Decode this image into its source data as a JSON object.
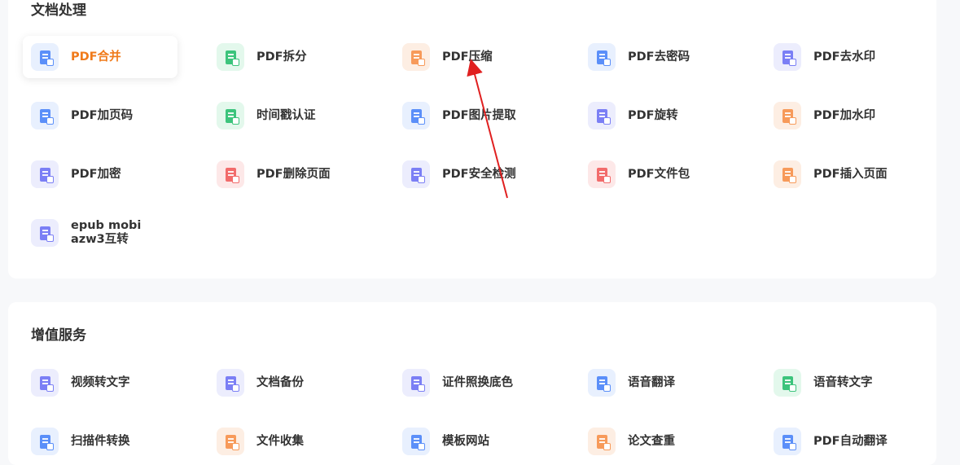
{
  "doc_section": {
    "title": "文档处理",
    "tools": [
      {
        "label": "PDF合并",
        "icon": "pdf-merge-icon",
        "color": "#5b8ff9",
        "bg": "#e8f0fe",
        "active": true
      },
      {
        "label": "PDF拆分",
        "icon": "pdf-split-icon",
        "color": "#3cc47c",
        "bg": "#e3f8ec"
      },
      {
        "label": "PDF压缩",
        "icon": "pdf-compress-icon",
        "color": "#f79a5a",
        "bg": "#fdeee3"
      },
      {
        "label": "PDF去密码",
        "icon": "pdf-remove-password-icon",
        "color": "#5b8ff9",
        "bg": "#e8f0fe"
      },
      {
        "label": "PDF去水印",
        "icon": "pdf-remove-watermark-icon",
        "color": "#7b7ff5",
        "bg": "#ecedfd"
      },
      {
        "label": "PDF加页码",
        "icon": "pdf-add-page-number-icon",
        "color": "#5b8ff9",
        "bg": "#e8f0fe"
      },
      {
        "label": "时间戳认证",
        "icon": "timestamp-icon",
        "color": "#3cc47c",
        "bg": "#e3f8ec"
      },
      {
        "label": "PDF图片提取",
        "icon": "pdf-image-extract-icon",
        "color": "#5b8ff9",
        "bg": "#e8f0fe"
      },
      {
        "label": "PDF旋转",
        "icon": "pdf-rotate-icon",
        "color": "#7b7ff5",
        "bg": "#ecedfd"
      },
      {
        "label": "PDF加水印",
        "icon": "pdf-add-watermark-icon",
        "color": "#f79a5a",
        "bg": "#fdeee3"
      },
      {
        "label": "PDF加密",
        "icon": "pdf-encrypt-icon",
        "color": "#7b7ff5",
        "bg": "#ecedfd"
      },
      {
        "label": "PDF删除页面",
        "icon": "pdf-delete-page-icon",
        "color": "#f26b6b",
        "bg": "#fde8e8"
      },
      {
        "label": "PDF安全检测",
        "icon": "pdf-security-check-icon",
        "color": "#7b7ff5",
        "bg": "#ecedfd"
      },
      {
        "label": "PDF文件包",
        "icon": "pdf-file-package-icon",
        "color": "#f26b6b",
        "bg": "#fde8e8"
      },
      {
        "label": "PDF插入页面",
        "icon": "pdf-insert-page-icon",
        "color": "#f79a5a",
        "bg": "#fdeee3"
      },
      {
        "label": "epub mobi\nazw3互转",
        "icon": "ebook-convert-icon",
        "color": "#7b7ff5",
        "bg": "#ecedfd"
      }
    ]
  },
  "vas_section": {
    "title": "增值服务",
    "tools": [
      {
        "label": "视频转文字",
        "icon": "video-to-text-icon",
        "color": "#7b7ff5",
        "bg": "#ecedfd"
      },
      {
        "label": "文档备份",
        "icon": "document-backup-icon",
        "color": "#7b7ff5",
        "bg": "#ecedfd"
      },
      {
        "label": "证件照换底色",
        "icon": "id-photo-icon",
        "color": "#7b7ff5",
        "bg": "#ecedfd"
      },
      {
        "label": "语音翻译",
        "icon": "voice-translate-icon",
        "color": "#5b8ff9",
        "bg": "#e8f0fe"
      },
      {
        "label": "语音转文字",
        "icon": "voice-to-text-icon",
        "color": "#3cc47c",
        "bg": "#e3f8ec"
      },
      {
        "label": "扫描件转换",
        "icon": "scan-convert-icon",
        "color": "#5b8ff9",
        "bg": "#e8f0fe"
      },
      {
        "label": "文件收集",
        "icon": "file-collect-icon",
        "color": "#f79a5a",
        "bg": "#fdeee3"
      },
      {
        "label": "模板网站",
        "icon": "template-site-icon",
        "color": "#5b8ff9",
        "bg": "#e8f0fe"
      },
      {
        "label": "论文查重",
        "icon": "paper-check-icon",
        "color": "#f79a5a",
        "bg": "#fdeee3"
      },
      {
        "label": "PDF自动翻译",
        "icon": "pdf-auto-translate-icon",
        "color": "#5b8ff9",
        "bg": "#e8f0fe"
      }
    ]
  },
  "annotation": {
    "arrow_color": "#e02020"
  }
}
